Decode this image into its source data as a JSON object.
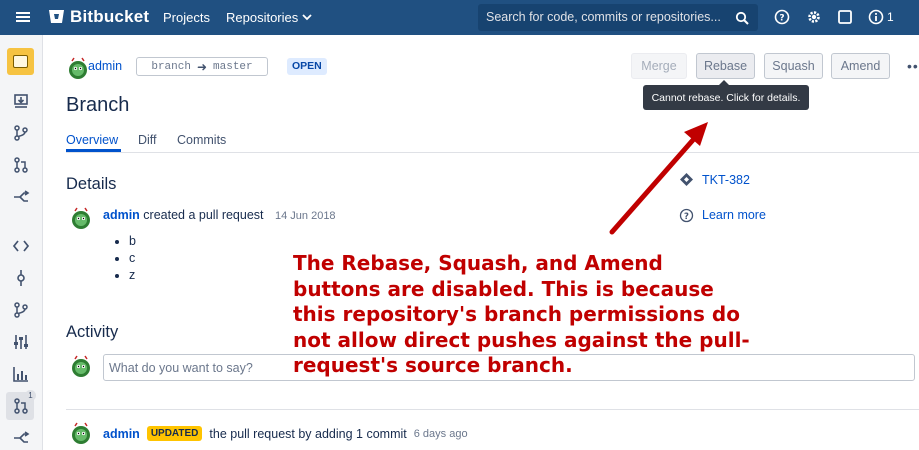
{
  "topbar": {
    "brand": "Bitbucket",
    "nav_projects": "Projects",
    "nav_repositories": "Repositories",
    "search_placeholder": "Search for code, commits or repositories...",
    "notification_count": "1"
  },
  "pr": {
    "author": "admin",
    "source_branch": "branch",
    "target_branch": "master",
    "status": "OPEN",
    "title": "Branch"
  },
  "actions": {
    "merge": "Merge",
    "rebase": "Rebase",
    "squash": "Squash",
    "amend": "Amend",
    "more": "•••",
    "tooltip": "Cannot rebase. Click for details."
  },
  "tabs": [
    "Overview",
    "Diff",
    "Commits"
  ],
  "details": {
    "heading": "Details",
    "author": "admin",
    "action": "created a pull request",
    "date": "14 Jun 2018",
    "items": [
      "b",
      "c",
      "z"
    ]
  },
  "activity": {
    "heading": "Activity",
    "comment_placeholder": "What do you want to say?",
    "event_author": "admin",
    "event_badge": "UPDATED",
    "event_text": "the pull request by adding 1 commit",
    "event_time": "6 days ago"
  },
  "side_panel": {
    "issue_key": "TKT-382",
    "learn_more": "Learn more"
  },
  "annotation": {
    "text": "The Rebase, Squash, and Amend buttons are disabled. This is because this repository's branch permissions do not allow direct pushes against the pull-request's source branch."
  },
  "colors": {
    "topbar": "#205081",
    "link": "#0052cc",
    "annotation": "#c00000",
    "open_lozenge": "#deebff",
    "updated_lozenge": "#ffc400"
  }
}
